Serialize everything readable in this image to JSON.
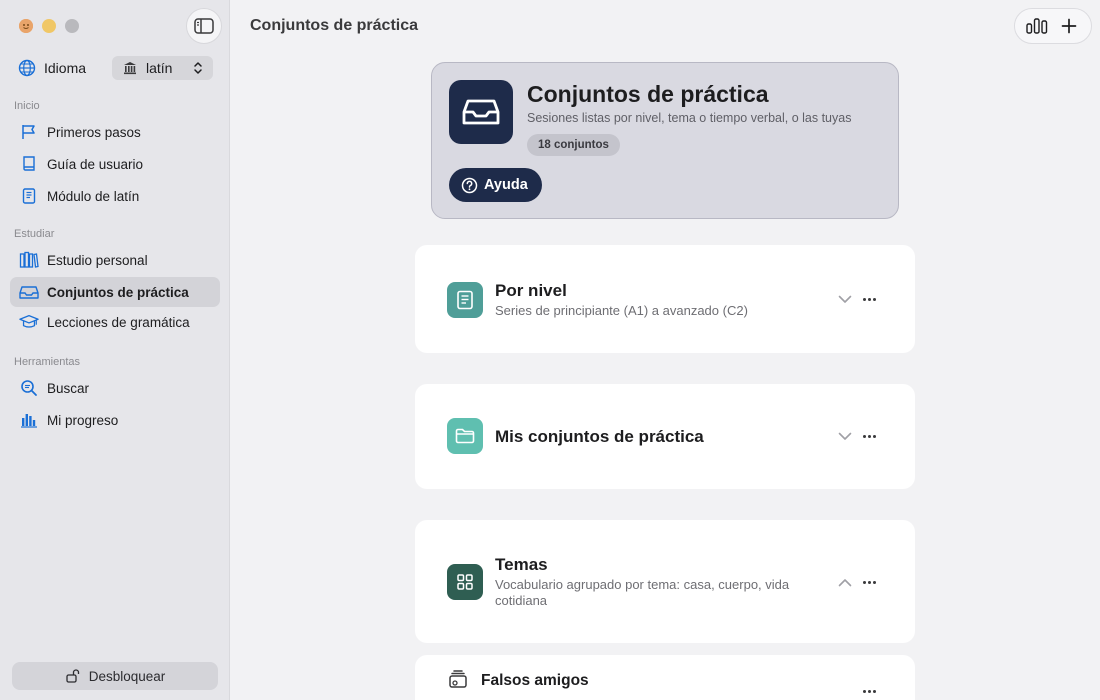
{
  "window": {
    "controls": [
      "close",
      "minimize",
      "zoom"
    ]
  },
  "sidebar": {
    "language_label": "Idioma",
    "language_value": "latín",
    "sections": [
      {
        "header": "Inicio",
        "items": [
          {
            "label": "Primeros pasos",
            "icon": "flag-icon"
          },
          {
            "label": "Guía de usuario",
            "icon": "book-icon"
          },
          {
            "label": "Módulo de latín",
            "icon": "book-module-icon"
          }
        ]
      },
      {
        "header": "Estudiar",
        "items": [
          {
            "label": "Estudio personal",
            "icon": "books-icon"
          },
          {
            "label": "Conjuntos de práctica",
            "icon": "tray-icon",
            "active": true
          },
          {
            "label": "Lecciones de gramática",
            "icon": "graduation-cap-icon"
          }
        ]
      },
      {
        "header": "Herramientas",
        "items": [
          {
            "label": "Buscar",
            "icon": "search-icon"
          },
          {
            "label": "Mi progreso",
            "icon": "bar-chart-icon"
          }
        ]
      }
    ],
    "unlock_label": "Desbloquear"
  },
  "main": {
    "title": "Conjuntos de práctica",
    "hero": {
      "title": "Conjuntos de práctica",
      "subtitle": "Sesiones listas por nivel, tema o tiempo verbal, o las tuyas",
      "badge": "18 conjuntos",
      "help_label": "Ayuda"
    },
    "cards": [
      {
        "title": "Por nivel",
        "subtitle": "Series de principiante (A1) a avanzado (C2)",
        "expanded": false,
        "icon_color": "#4f9e98"
      },
      {
        "title": "Mis conjuntos de práctica",
        "subtitle": "",
        "expanded": false,
        "icon_color": "#5fbfb0"
      },
      {
        "title": "Temas",
        "subtitle": "Vocabulario agrupado por tema: casa, cuerpo, vida cotidiana",
        "expanded": true,
        "icon_color": "#2f5e52"
      },
      {
        "title": "Falsos amigos",
        "subtitle": "",
        "expanded": false
      }
    ]
  },
  "colors": {
    "accent": "#1a6fd6",
    "hero_bg": "#d9d9e1",
    "navy": "#1e2b4a"
  }
}
